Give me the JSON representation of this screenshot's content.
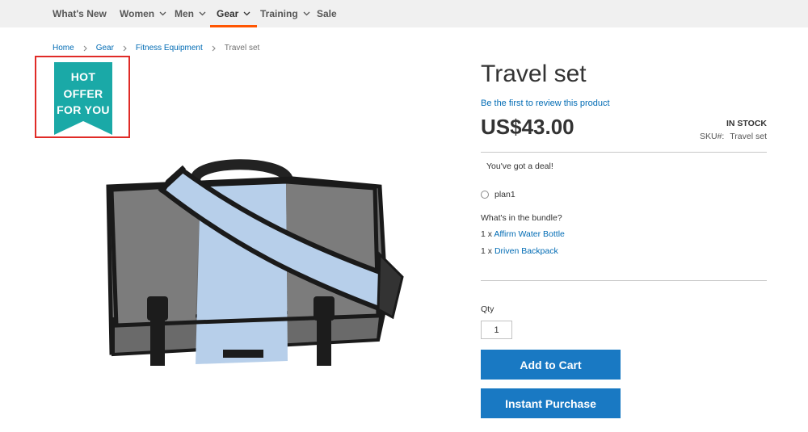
{
  "nav": {
    "items": [
      {
        "label": "What's New",
        "has_dropdown": false
      },
      {
        "label": "Women",
        "has_dropdown": true
      },
      {
        "label": "Men",
        "has_dropdown": true
      },
      {
        "label": "Gear",
        "has_dropdown": true,
        "active": true
      },
      {
        "label": "Training",
        "has_dropdown": true
      },
      {
        "label": "Sale",
        "has_dropdown": false
      }
    ],
    "active_color": "#ff5501"
  },
  "breadcrumbs": {
    "items": [
      "Home",
      "Gear",
      "Fitness Equipment"
    ],
    "current": "Travel set"
  },
  "badge": {
    "lines": [
      "HOT",
      "OFFER",
      "FOR YOU"
    ],
    "color": "#1aa9a7",
    "highlight_color": "#e02b27"
  },
  "product": {
    "title": "Travel set",
    "review_link": "Be the first to review this product",
    "price": "US$43.00",
    "stock": "IN STOCK",
    "sku_label": "SKU#:",
    "sku_value": "Travel set",
    "deal_text": "You've got a deal!",
    "option_label": "plan1",
    "bundle_title": "What's in the bundle?",
    "bundle_items": [
      {
        "qty": "1 x",
        "name": "Affirm Water Bottle"
      },
      {
        "qty": "1 x",
        "name": "Driven Backpack"
      }
    ],
    "image_icon": "messenger-bag-image"
  },
  "purchase": {
    "qty_label": "Qty",
    "qty_value": "1",
    "add_to_cart": "Add to Cart",
    "instant_purchase": "Instant Purchase",
    "button_color": "#1979c3"
  }
}
